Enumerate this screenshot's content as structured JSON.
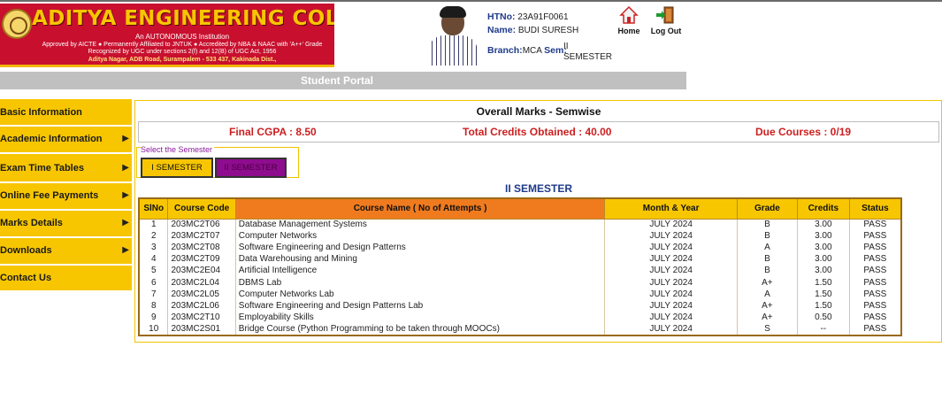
{
  "header": {
    "college_name": "ADITYA ENGINEERING COLLEGE",
    "tagline": "An AUTONOMOUS Institution",
    "approval_line1": "Approved by AICTE ● Permanently Affiliated to JNTUK ● Accredited by NBA & NAAC with 'A++' Grade",
    "approval_line2": "Recognized by UGC under sections 2(f) and 12(B) of UGC Act, 1956",
    "address": "Aditya Nagar, ADB Road, Surampalem - 533 437, Kakinada Dist.,",
    "student": {
      "htno_label": "HTNo:",
      "htno": "23A91F0061",
      "name_label": "Name:",
      "name": "BUDI SURESH",
      "branch_label": "Branch:",
      "branch": "MCA",
      "sem_label": "Sem:",
      "sem_line1": "II",
      "sem_line2": "SEMESTER"
    },
    "home_label": "Home",
    "logout_label": "Log Out",
    "portal_title": "Student Portal"
  },
  "sidebar": {
    "items": [
      {
        "label": "Basic Information",
        "arrow": ""
      },
      {
        "label": "Academic Information",
        "arrow": "▶"
      },
      {
        "label": "Exam Time Tables",
        "arrow": "▶"
      },
      {
        "label": "Online Fee Payments",
        "arrow": "▶"
      },
      {
        "label": "Marks Details",
        "arrow": "▶"
      },
      {
        "label": "Downloads",
        "arrow": "▶"
      },
      {
        "label": "Contact Us",
        "arrow": ""
      }
    ]
  },
  "main": {
    "title": "Overall Marks - Semwise",
    "final_cgpa": "Final CGPA : 8.50",
    "total_credits": "Total Credits Obtained : 40.00",
    "due_courses": "Due Courses : 0/19",
    "select_legend": "Select the Semester",
    "sem_buttons": [
      "I SEMESTER",
      "II SEMESTER"
    ],
    "semester_heading": "II SEMESTER"
  },
  "table": {
    "headers": [
      "SlNo",
      "Course Code",
      "Course Name ( No of Attempts )",
      "Month & Year",
      "Grade",
      "Credits",
      "Status"
    ],
    "rows": [
      [
        "1",
        "203MC2T06",
        "Database Management Systems",
        "JULY 2024",
        "B",
        "3.00",
        "PASS"
      ],
      [
        "2",
        "203MC2T07",
        "Computer Networks",
        "JULY 2024",
        "B",
        "3.00",
        "PASS"
      ],
      [
        "3",
        "203MC2T08",
        "Software Engineering and Design Patterns",
        "JULY 2024",
        "A",
        "3.00",
        "PASS"
      ],
      [
        "4",
        "203MC2T09",
        "Data Warehousing and Mining",
        "JULY 2024",
        "B",
        "3.00",
        "PASS"
      ],
      [
        "5",
        "203MC2E04",
        "Artificial Intelligence",
        "JULY 2024",
        "B",
        "3.00",
        "PASS"
      ],
      [
        "6",
        "203MC2L04",
        "DBMS Lab",
        "JULY 2024",
        "A+",
        "1.50",
        "PASS"
      ],
      [
        "7",
        "203MC2L05",
        "Computer Networks Lab",
        "JULY 2024",
        "A",
        "1.50",
        "PASS"
      ],
      [
        "8",
        "203MC2L06",
        "Software Engineering and Design Patterns Lab",
        "JULY 2024",
        "A+",
        "1.50",
        "PASS"
      ],
      [
        "9",
        "203MC2T10",
        "Employability Skills",
        "JULY 2024",
        "A+",
        "0.50",
        "PASS"
      ],
      [
        "10",
        "203MC2S01",
        "Bridge Course (Python Programming to be taken through MOOCs)",
        "JULY 2024",
        "S",
        "--",
        "PASS"
      ]
    ]
  },
  "colors": {
    "banner_red": "#c8102e",
    "accent_yellow": "#f7c600",
    "header_orange": "#f07b1f",
    "stat_red": "#cc1f1f",
    "heading_blue": "#1f3b8a",
    "selected_sem_purple": "#8e0c8e"
  }
}
